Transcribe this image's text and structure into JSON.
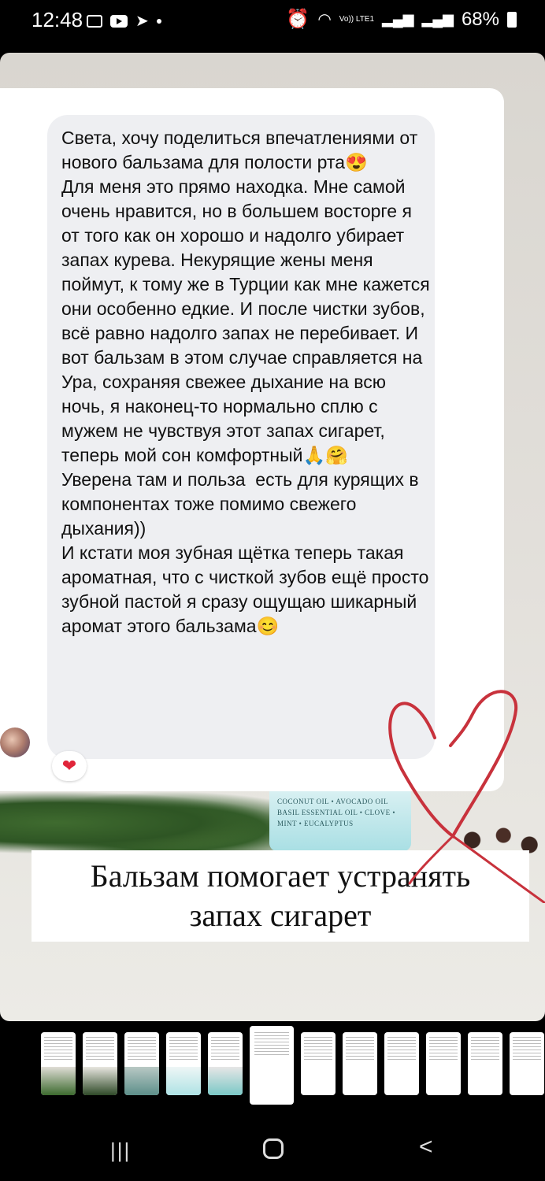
{
  "status_bar": {
    "time": "12:48",
    "left_icons": [
      "gallery-icon",
      "youtube-icon",
      "telegram-icon",
      "dot-icon"
    ],
    "right_icons": [
      "alarm-icon",
      "wifi-icon",
      "volte-icon",
      "signal-icon",
      "signal-roaming-icon"
    ],
    "network_label": "Vo)) LTE1",
    "battery": "68%"
  },
  "message": {
    "text": "Света, хочу поделиться впечатлениями от нового бальзама для полости рта😍\nДля меня это прямо находка. Мне самой очень нравится, но в большем восторге я от того как он хорошо и надолго убирает запах курева. Некурящие жены меня поймут, к тому же в Турции как мне кажется они особенно едкие. И после чистки зубов, всё равно надолго запах не перебивает. И вот бальзам в этом случае справляется на Ура, сохраняя свежее дыхание на всю ночь, я наконец-то нормально сплю с мужем не чувствуя этот запах сигарет, теперь мой сон комфортный🙏🤗\nУверена там и польза  есть для курящих в компонентах тоже помимо свежего дыхания))\nИ кстати моя зубная щётка теперь такая ароматная, что с чисткой зубов ещё просто зубной пастой я сразу ощущаю шикарный аромат этого бальзама😊",
    "reaction": "❤"
  },
  "jar_label": {
    "line1": "COCONUT OIL • AVOCADO OIL",
    "line2": "BASIL ESSENTIAL OIL • CLOVE • MINT • EUCALYPTUS"
  },
  "caption": {
    "line1": "Бальзам помогает устранять",
    "line2": "запах сигарет"
  },
  "thumbnails": {
    "count": 12,
    "active_index": 5
  },
  "colors": {
    "heart_stroke": "#c8323c",
    "bubble_bg": "#eeeff2",
    "reaction_red": "#e0253a"
  },
  "nav": {
    "recent": "|||",
    "back": "<"
  }
}
